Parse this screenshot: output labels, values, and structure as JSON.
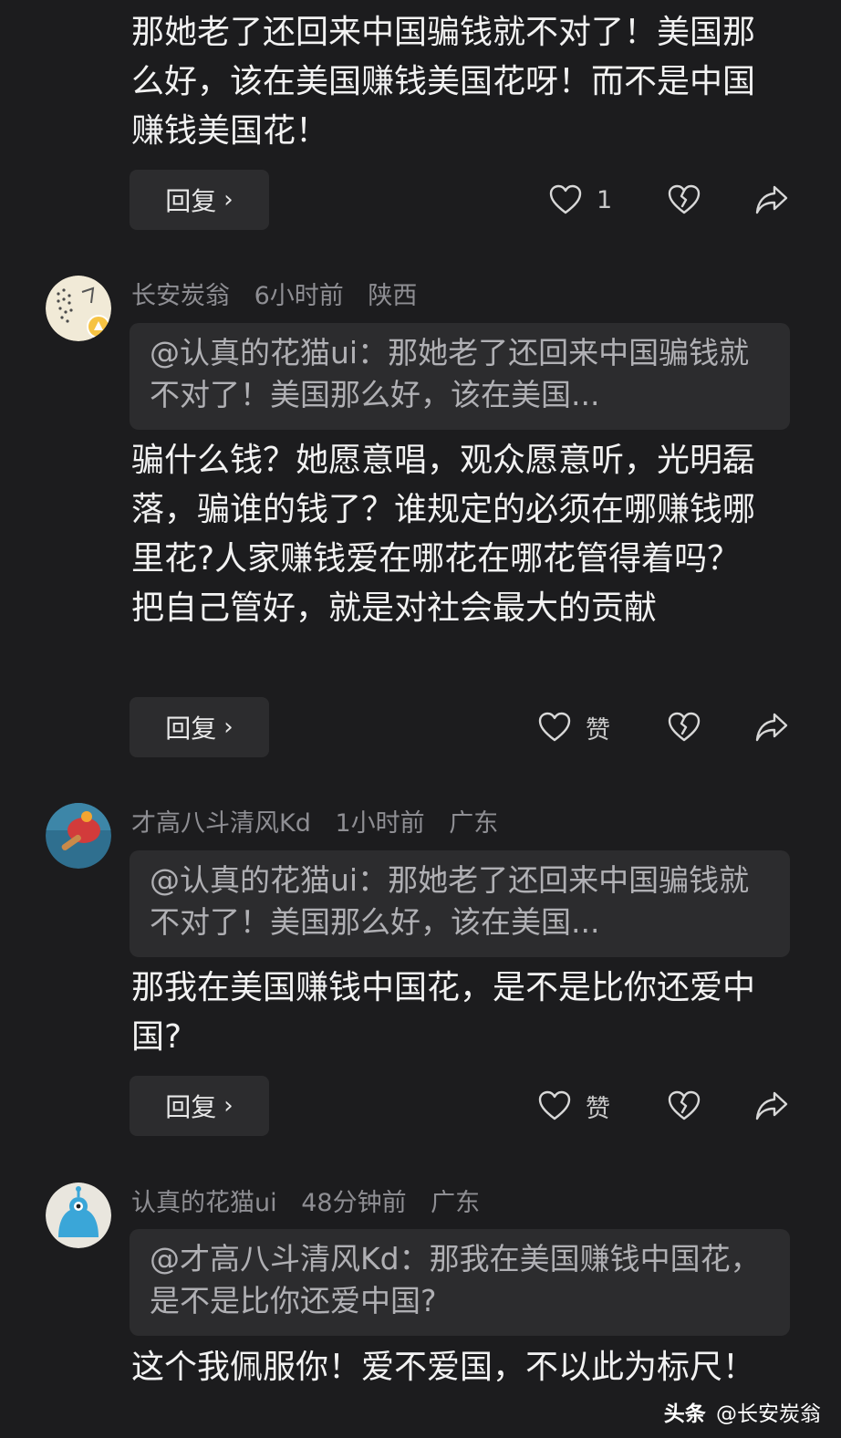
{
  "comments": [
    {
      "text": "那她老了还回来中国骗钱就不对了！美国那么好，该在美国赚钱美国花呀！而不是中国赚钱美国花！",
      "reply_label": "回复",
      "like_label": "1"
    },
    {
      "author": "长安炭翁",
      "time": "6小时前",
      "location": "陕西",
      "quote": "@认真的花猫ui：那她老了还回来中国骗钱就不对了！美国那么好，该在美国...",
      "text": "骗什么钱？她愿意唱，观众愿意听，光明磊落，骗谁的钱了？谁规定的必须在哪赚钱哪里花?人家赚钱爱在哪花在哪花管得着吗？把自己管好，就是对社会最大的贡献",
      "reply_label": "回复",
      "like_label": "赞"
    },
    {
      "author": "才高八斗清风Kd",
      "time": "1小时前",
      "location": "广东",
      "quote": "@认真的花猫ui：那她老了还回来中国骗钱就不对了！美国那么好，该在美国...",
      "text": "那我在美国赚钱中国花，是不是比你还爱中国?",
      "reply_label": "回复",
      "like_label": "赞"
    },
    {
      "author": "认真的花猫ui",
      "time": "48分钟前",
      "location": "广东",
      "quote": "@才高八斗清风Kd：那我在美国赚钱中国花，是不是比你还爱中国?",
      "text": "这个我佩服你！爱不爱国，不以此为标尺！"
    }
  ],
  "icons": {
    "like": "heart-outline-icon",
    "dislike": "broken-heart-icon",
    "share": "share-arrow-icon",
    "reply_chevron": "chevron-right-icon"
  },
  "watermark": {
    "brand": "头条",
    "handle": "@长安炭翁"
  },
  "colors": {
    "background": "#1c1c1e",
    "card": "#2c2c2e",
    "text": "#f2f2f2",
    "meta": "#8e8e93",
    "quote_text": "#b0b0b4"
  }
}
